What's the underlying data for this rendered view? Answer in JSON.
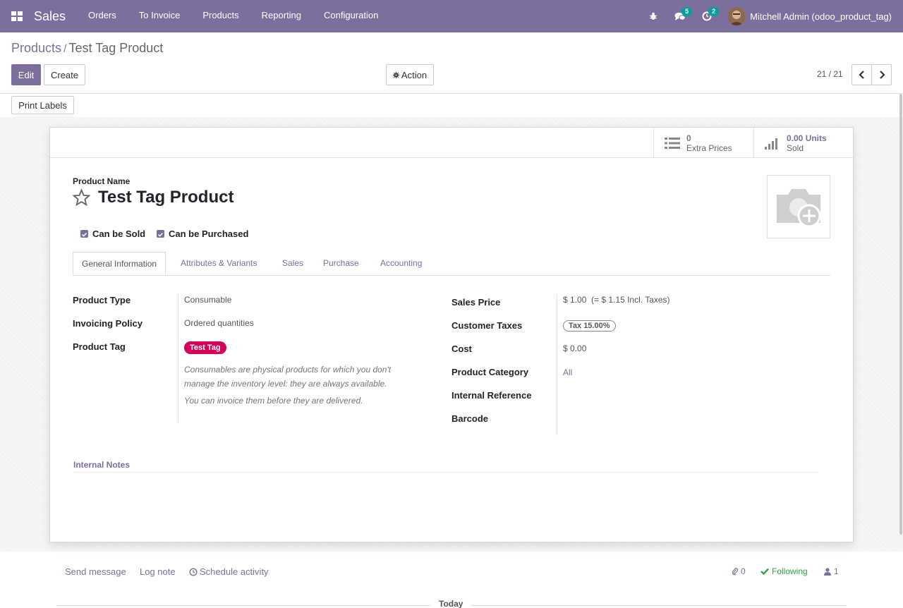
{
  "navbar": {
    "app_name": "Sales",
    "menu": [
      "Orders",
      "To Invoice",
      "Products",
      "Reporting",
      "Configuration"
    ],
    "messages_count": "5",
    "activities_count": "2",
    "user_name": "Mitchell Admin (odoo_product_tag)",
    "bg_color": "#7c6f9d"
  },
  "breadcrumb": {
    "parent": "Products",
    "separator": "/",
    "current": "Test Tag Product"
  },
  "toolbar": {
    "edit_label": "Edit",
    "create_label": "Create",
    "action_label": "Action",
    "pager_text": "21 / 21",
    "print_labels": "Print Labels"
  },
  "stat_buttons": {
    "extra_prices_value": "0",
    "extra_prices_label": "Extra Prices",
    "sold_value": "0.00 Units",
    "sold_label": "Sold"
  },
  "product": {
    "name_label": "Product Name",
    "name": "Test Tag Product",
    "can_be_sold_label": "Can be Sold",
    "can_be_sold": true,
    "can_be_purchased_label": "Can be Purchased",
    "can_be_purchased": true
  },
  "tabs": [
    "General Information",
    "Attributes & Variants",
    "Sales",
    "Purchase",
    "Accounting"
  ],
  "general": {
    "product_type_label": "Product Type",
    "product_type": "Consumable",
    "invoicing_policy_label": "Invoicing Policy",
    "invoicing_policy": "Ordered quantities",
    "product_tag_label": "Product Tag",
    "product_tag": "Test Tag",
    "help_line1": "Consumables are physical products for which you don't",
    "help_line2": "manage the inventory level: they are always available.",
    "help_line3": "You can invoice them before they are delivered.",
    "sales_price_label": "Sales Price",
    "sales_price": "$ 1.00",
    "sales_price_incl": "(= $ 1.15 Incl. Taxes)",
    "customer_taxes_label": "Customer Taxes",
    "customer_taxes": "Tax 15.00%",
    "cost_label": "Cost",
    "cost": "$ 0.00",
    "product_category_label": "Product Category",
    "product_category": "All",
    "internal_reference_label": "Internal Reference",
    "barcode_label": "Barcode",
    "internal_notes_label": "Internal Notes"
  },
  "chatter": {
    "send_message": "Send message",
    "log_note": "Log note",
    "schedule_activity": "Schedule activity",
    "attachments_count": "0",
    "following_label": "Following",
    "followers_count": "1",
    "today_label": "Today"
  }
}
